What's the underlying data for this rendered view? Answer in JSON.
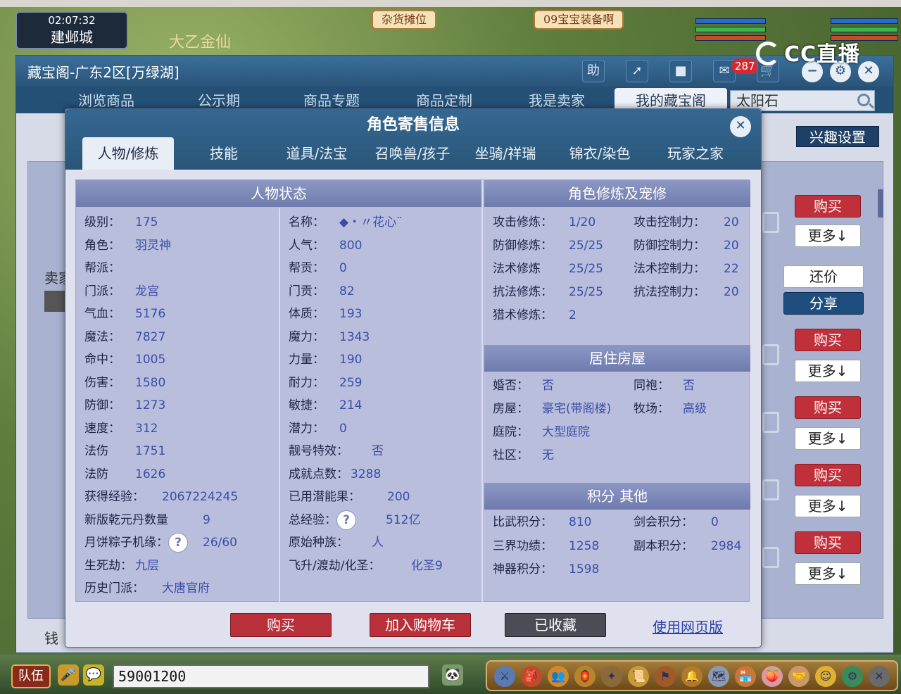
{
  "game": {
    "time": "02:07:32",
    "city": "建邺城",
    "player_title": "大乙金仙",
    "stall_left": "杂货摊位",
    "stall_right": "09宝宝装备啊",
    "stream_logo": "CC直播",
    "chat_value": "59001200",
    "team_label": "队伍"
  },
  "app": {
    "title": "藏宝阁-广东2区[万绿湖]",
    "help_label": "助",
    "cart_count": "287",
    "nav": [
      "浏览商品",
      "公示期",
      "商品专题",
      "商品定制",
      "我是卖家",
      "我的藏宝阁"
    ],
    "search_value": "太阳石",
    "interest_label": "兴趣设置",
    "seller_label": "卖家",
    "money_label": "钱",
    "side": {
      "buy": "购买",
      "more": "更多↓",
      "bargain": "还价",
      "share": "分享"
    }
  },
  "modal": {
    "title": "角色寄售信息",
    "tabs": [
      "人物/修炼",
      "技能",
      "道具/法宝",
      "召唤兽/孩子",
      "坐骑/祥瑞",
      "锦衣/染色",
      "玩家之家"
    ],
    "sections": {
      "status": "人物状态",
      "cultivation": "角色修炼及宠修",
      "house": "居住房屋",
      "points": "积分 其他"
    },
    "status_left": [
      {
        "k": "级别：",
        "v": "175"
      },
      {
        "k": "角色：",
        "v": "羽灵神"
      },
      {
        "k": "帮派：",
        "v": ""
      },
      {
        "k": "门派：",
        "v": "龙宫"
      },
      {
        "k": "气血：",
        "v": "5176"
      },
      {
        "k": "魔法：",
        "v": "7827"
      },
      {
        "k": "命中：",
        "v": "1005"
      },
      {
        "k": "伤害：",
        "v": "1580"
      },
      {
        "k": "防御：",
        "v": "1273"
      },
      {
        "k": "速度：",
        "v": "312"
      },
      {
        "k": "法伤",
        "v": "1751"
      },
      {
        "k": "法防",
        "v": "1626"
      },
      {
        "k": "获得经验：",
        "v": "2067224245"
      },
      {
        "k": "新版乾元丹数量",
        "v": "9"
      },
      {
        "k": "月饼粽子机缘：",
        "v": "26/60"
      },
      {
        "k": "生死劫：",
        "v": "九层"
      },
      {
        "k": "历史门派：",
        "v": "大唐官府"
      }
    ],
    "status_right": [
      {
        "k": "名称：",
        "v": "◆・〃花心¨"
      },
      {
        "k": "人气：",
        "v": "800"
      },
      {
        "k": "帮贡：",
        "v": "0"
      },
      {
        "k": "门贡：",
        "v": "82"
      },
      {
        "k": "体质：",
        "v": "193"
      },
      {
        "k": "魔力：",
        "v": "1343"
      },
      {
        "k": "力量：",
        "v": "190"
      },
      {
        "k": "耐力：",
        "v": "259"
      },
      {
        "k": "敏捷：",
        "v": "214"
      },
      {
        "k": "潜力：",
        "v": "0"
      },
      {
        "k": "靓号特效：",
        "v": "否"
      },
      {
        "k": "成就点数：",
        "v": "3288"
      },
      {
        "k": "已用潜能果：",
        "v": "200"
      },
      {
        "k": "总经验：",
        "v": "512亿"
      },
      {
        "k": "原始种族：",
        "v": "人"
      },
      {
        "k": "飞升/渡劫/化圣：",
        "v": "化圣9"
      }
    ],
    "cult_left": [
      {
        "k": "攻击修炼：",
        "v": "1/20"
      },
      {
        "k": "防御修炼：",
        "v": "25/25"
      },
      {
        "k": "法术修炼",
        "v": "25/25"
      },
      {
        "k": "抗法修炼：",
        "v": "25/25"
      },
      {
        "k": "猎术修炼：",
        "v": "2"
      }
    ],
    "cult_right": [
      {
        "k": "攻击控制力：",
        "v": "20"
      },
      {
        "k": "防御控制力：",
        "v": "20"
      },
      {
        "k": "法术控制力：",
        "v": "22"
      },
      {
        "k": "抗法控制力：",
        "v": "20"
      }
    ],
    "house_left": [
      {
        "k": "婚否：",
        "v": "否"
      },
      {
        "k": "房屋：",
        "v": "豪宅(带阁楼)"
      },
      {
        "k": "庭院：",
        "v": "大型庭院"
      },
      {
        "k": "社区：",
        "v": "无"
      }
    ],
    "house_right": [
      {
        "k": "同袍：",
        "v": "否"
      },
      {
        "k": "牧场：",
        "v": "高级"
      }
    ],
    "points_left": [
      {
        "k": "比武积分：",
        "v": "810"
      },
      {
        "k": "三界功绩：",
        "v": "1258"
      },
      {
        "k": "神器积分：",
        "v": "1598"
      }
    ],
    "points_right": [
      {
        "k": "剑会积分：",
        "v": "0"
      },
      {
        "k": "副本积分：",
        "v": "2984"
      }
    ],
    "help_glyph": "?",
    "buttons": {
      "buy": "购买",
      "add_cart": "加入购物车",
      "favorited": "已收藏",
      "web_version": "使用网页版"
    }
  }
}
